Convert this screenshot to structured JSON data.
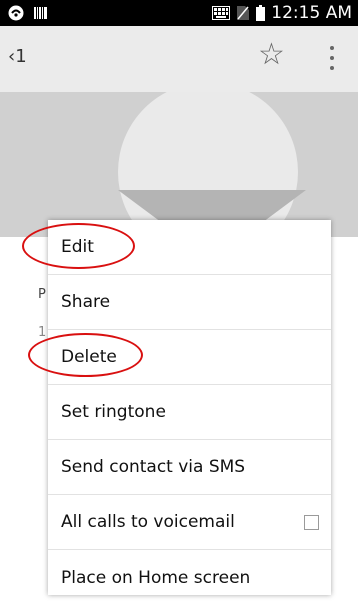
{
  "status_bar": {
    "time": "12:15 AM"
  },
  "header": {
    "back_label": "1"
  },
  "contact_behind": {
    "section_letter": "P",
    "number_prefix": "1"
  },
  "menu": {
    "items": [
      {
        "label": "Edit"
      },
      {
        "label": "Share"
      },
      {
        "label": "Delete"
      },
      {
        "label": "Set ringtone"
      },
      {
        "label": "Send contact via SMS"
      },
      {
        "label": "All calls to voicemail",
        "checked": false
      },
      {
        "label": "Place on Home screen"
      }
    ]
  },
  "colors": {
    "annotation": "#d91010",
    "photo_bg": "#d0d0d0"
  }
}
